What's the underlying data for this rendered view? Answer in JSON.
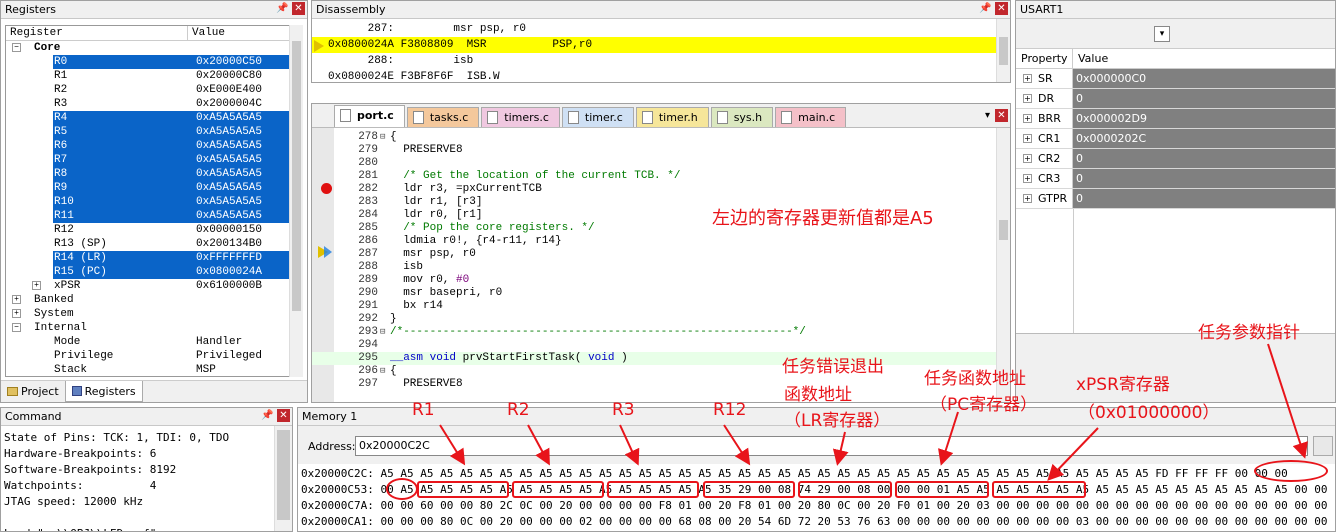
{
  "registers": {
    "title": "Registers",
    "col_register": "Register",
    "col_value": "Value",
    "core_label": "Core",
    "rows": [
      {
        "name": "R0",
        "value": "0x20000C50",
        "sel": true
      },
      {
        "name": "R1",
        "value": "0x20000C80",
        "sel": false
      },
      {
        "name": "R2",
        "value": "0xE000E400",
        "sel": false
      },
      {
        "name": "R3",
        "value": "0x2000004C",
        "sel": false
      },
      {
        "name": "R4",
        "value": "0xA5A5A5A5",
        "sel": true
      },
      {
        "name": "R5",
        "value": "0xA5A5A5A5",
        "sel": true
      },
      {
        "name": "R6",
        "value": "0xA5A5A5A5",
        "sel": true
      },
      {
        "name": "R7",
        "value": "0xA5A5A5A5",
        "sel": true
      },
      {
        "name": "R8",
        "value": "0xA5A5A5A5",
        "sel": true
      },
      {
        "name": "R9",
        "value": "0xA5A5A5A5",
        "sel": true
      },
      {
        "name": "R10",
        "value": "0xA5A5A5A5",
        "sel": true
      },
      {
        "name": "R11",
        "value": "0xA5A5A5A5",
        "sel": true
      },
      {
        "name": "R12",
        "value": "0x00000150",
        "sel": false
      },
      {
        "name": "R13 (SP)",
        "value": "0x200134B0",
        "sel": false
      },
      {
        "name": "R14 (LR)",
        "value": "0xFFFFFFFD",
        "sel": true
      },
      {
        "name": "R15 (PC)",
        "value": "0x0800024A",
        "sel": true
      },
      {
        "name": "xPSR",
        "value": "0x6100000B",
        "sel": false
      }
    ],
    "groups": [
      "Banked",
      "System",
      "Internal"
    ],
    "internal_rows": [
      {
        "name": "Mode",
        "value": "Handler"
      },
      {
        "name": "Privilege",
        "value": "Privileged"
      },
      {
        "name": "Stack",
        "value": "MSP"
      }
    ],
    "tab_project": "Project",
    "tab_registers": "Registers"
  },
  "disassembly": {
    "title": "Disassembly",
    "lines": [
      "      287:         msr psp, r0",
      "0x0800024A F3808809  MSR          PSP,r0",
      "      288:         isb",
      "0x0800024E F3BF8F6F  ISB.W"
    ]
  },
  "editor": {
    "tabs": [
      {
        "label": "port.c",
        "color": "#f8e8a0",
        "active": true
      },
      {
        "label": "tasks.c",
        "color": "#f4c89c"
      },
      {
        "label": "timers.c",
        "color": "#f0c8e0"
      },
      {
        "label": "timer.c",
        "color": "#cfe0f4"
      },
      {
        "label": "timer.h",
        "color": "#f6e69a"
      },
      {
        "label": "sys.h",
        "color": "#dbe8c0"
      },
      {
        "label": "main.c",
        "color": "#f4c0c8"
      }
    ],
    "lines": [
      {
        "n": "278",
        "c": "{"
      },
      {
        "n": "279",
        "c": "  PRESERVE8"
      },
      {
        "n": "280",
        "c": ""
      },
      {
        "n": "281",
        "c": "  /* Get the location of the current TCB. */"
      },
      {
        "n": "282",
        "c": "  ldr r3, =pxCurrentTCB"
      },
      {
        "n": "283",
        "c": "  ldr r1, [r3]"
      },
      {
        "n": "284",
        "c": "  ldr r0, [r1]"
      },
      {
        "n": "285",
        "c": "  /* Pop the core registers. */"
      },
      {
        "n": "286",
        "c": "  ldmia r0!, {r4-r11, r14}"
      },
      {
        "n": "287",
        "c": "  msr psp, r0"
      },
      {
        "n": "288",
        "c": "  isb"
      },
      {
        "n": "289",
        "c": "  mov r0, #0"
      },
      {
        "n": "290",
        "c": "  msr basepri, r0"
      },
      {
        "n": "291",
        "c": "  bx r14"
      },
      {
        "n": "292",
        "c": "}"
      },
      {
        "n": "293",
        "c": "/*-----------------------------------------------------------*/"
      },
      {
        "n": "294",
        "c": ""
      },
      {
        "n": "295",
        "c": "__asm void prvStartFirstTask( void )"
      },
      {
        "n": "296",
        "c": "{"
      },
      {
        "n": "297",
        "c": "  PRESERVE8"
      }
    ],
    "note": "左边的寄存器更新值都是A5"
  },
  "usart": {
    "title": "USART1",
    "col_property": "Property",
    "col_value": "Value",
    "rows": [
      {
        "name": "SR",
        "value": "0x000000C0"
      },
      {
        "name": "DR",
        "value": "0"
      },
      {
        "name": "BRR",
        "value": "0x000002D9"
      },
      {
        "name": "CR1",
        "value": "0x0000202C"
      },
      {
        "name": "CR2",
        "value": "0"
      },
      {
        "name": "CR3",
        "value": "0"
      },
      {
        "name": "GTPR",
        "value": "0"
      }
    ]
  },
  "command": {
    "title": "Command",
    "lines": [
      "State of Pins: TCK: 1, TDI: 0, TDO",
      "Hardware-Breakpoints: 6",
      "Software-Breakpoints: 8192",
      "Watchpoints:          4",
      "JTAG speed: 12000 kHz",
      "",
      "Load \"..\\\\OBJ\\\\LED.axf\""
    ]
  },
  "memory": {
    "title": "Memory 1",
    "address_label": "Address:",
    "address_value": "0x20000C2C",
    "lines": [
      "0x20000C2C: A5 A5 A5 A5 A5 A5 A5 A5 A5 A5 A5 A5 A5 A5 A5 A5 A5 A5 A5 A5 A5 A5 A5 A5 A5 A5 A5 A5 A5 A5 A5 A5 A5 A5 A5 A5 A5 A5 A5 FD FF FF FF 00 00 00",
      "0x20000C53: 00 A5 A5 A5 A5 A5 A5 A5 A5 A5 A5 A5 A5 A5 A5 A5 A5 35 29 00 08 74 29 00 08 00 00 00 01 A5 A5 A5 A5 A5 A5 A5 A5 A5 A5 A5 A5 A5 A5 A5 A5 A5 00 00",
      "0x20000C7A: 00 00 60 00 00 80 2C 0C 00 20 00 00 00 00 F8 01 00 20 F8 01 00 20 80 0C 00 20 F0 01 00 20 03 00 00 00 00 00 00 00 00 00 00 00 00 00 00 00 00 00",
      "0x20000CA1: 00 00 00 80 0C 00 20 00 00 00 02 00 00 00 00 68 08 00 20 54 6D 72 20 53 76 63 00 00 00 00 00 00 00 00 00 03 00 00 00 00 00 00 00 00 00 00 00 00"
    ]
  },
  "annotations": {
    "r1": "R1",
    "r2": "R2",
    "r3": "R3",
    "r12": "R12",
    "lr_l1": "任务错误退出",
    "lr_l2": "函数地址",
    "lr_l3": "（LR寄存器）",
    "pc_l1": "任务函数地址",
    "pc_l2": "（PC寄存器）",
    "xpsr_l1": "xPSR寄存器",
    "xpsr_l2": "（0x01000000）",
    "param": "任务参数指针"
  }
}
